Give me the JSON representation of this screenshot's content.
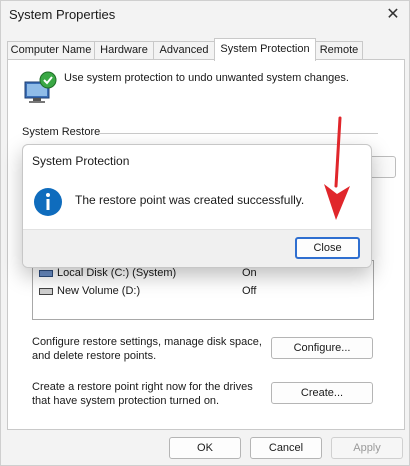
{
  "window": {
    "title": "System Properties",
    "close_glyph": "✕"
  },
  "tabs": [
    {
      "label": "Computer Name"
    },
    {
      "label": "Hardware"
    },
    {
      "label": "Advanced"
    },
    {
      "label": "System Protection",
      "active": true
    },
    {
      "label": "Remote"
    }
  ],
  "panel": {
    "intro": "Use system protection to undo unwanted system changes.",
    "system_restore_label": "System Restore",
    "drives": [
      {
        "name": "Local Disk (C:) (System)",
        "state": "On"
      },
      {
        "name": "New Volume (D:)",
        "state": "Off"
      }
    ],
    "configure_text": "Configure restore settings, manage disk space, and delete restore points.",
    "configure_button": "Configure...",
    "create_text": "Create a restore point right now for the drives that have system protection turned on.",
    "create_button": "Create..."
  },
  "footer": {
    "ok": "OK",
    "cancel": "Cancel",
    "apply": "Apply"
  },
  "dialog": {
    "title": "System Protection",
    "message": "The restore point was created successfully.",
    "close_button": "Close",
    "icon": "info-icon"
  },
  "annotation": {
    "arrow_color": "#e0262b"
  },
  "colors": {
    "accent": "#2f6fd0",
    "info_icon": "#0f6cbd"
  }
}
